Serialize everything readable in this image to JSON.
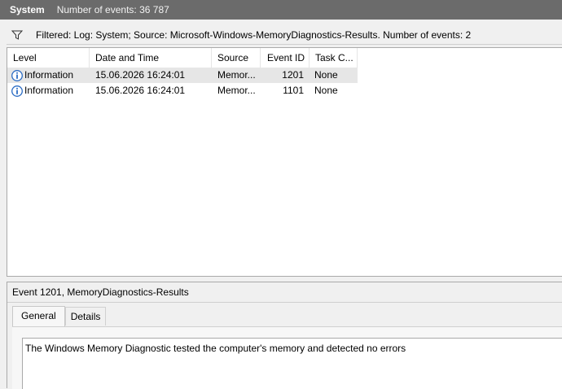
{
  "titlebar": {
    "log_name": "System",
    "event_count": "Number of events: 36 787"
  },
  "filter": {
    "icon": "filter-funnel-icon",
    "text": "Filtered: Log: System; Source: Microsoft-Windows-MemoryDiagnostics-Results. Number of events: 2"
  },
  "table": {
    "columns": [
      "Level",
      "Date and Time",
      "Source",
      "Event ID",
      "Task C..."
    ],
    "rows": [
      {
        "level": "Information",
        "date": "15.06.2026 16:24:01",
        "source": "Memor...",
        "event_id": "1201",
        "task": "None",
        "icon": "information-icon"
      },
      {
        "level": "Information",
        "date": "15.06.2026 16:24:01",
        "source": "Memor...",
        "event_id": "1101",
        "task": "None",
        "icon": "information-icon"
      }
    ]
  },
  "detail": {
    "title": "Event 1201, MemoryDiagnostics-Results",
    "tabs": [
      "General",
      "Details"
    ],
    "active_tab": "General",
    "message": "The Windows Memory Diagnostic tested the computer's memory and detected no errors"
  },
  "colors": {
    "titlebar_bg": "#6b6b6b",
    "info_icon": "#2b6cc4",
    "selected_row": "#e6e6e6"
  }
}
